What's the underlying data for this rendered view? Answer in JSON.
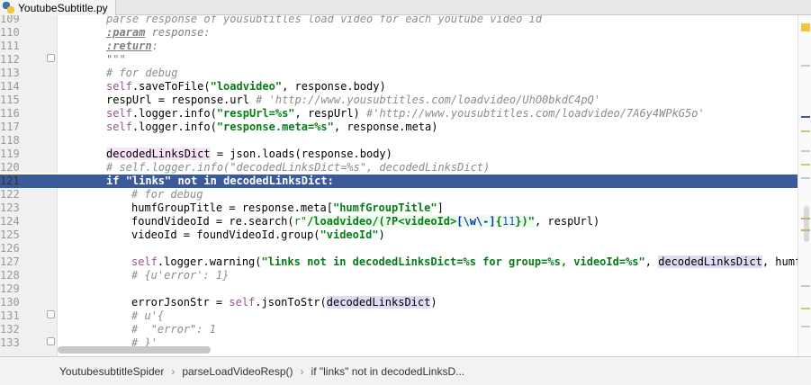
{
  "tab": {
    "title": "YoutubeSubtitle.py",
    "icon": "python-file-icon"
  },
  "editor": {
    "first_line_partial": "parse response of yousubtitles load video for each youtube video id",
    "lines": [
      {
        "n": "109"
      },
      {
        "n": "110"
      },
      {
        "n": "111"
      },
      {
        "n": "112"
      },
      {
        "n": "113"
      },
      {
        "n": "114"
      },
      {
        "n": "115"
      },
      {
        "n": "116"
      },
      {
        "n": "117"
      },
      {
        "n": "118"
      },
      {
        "n": "119"
      },
      {
        "n": "120"
      },
      {
        "n": "121"
      },
      {
        "n": "122"
      },
      {
        "n": "123"
      },
      {
        "n": "124"
      },
      {
        "n": "125"
      },
      {
        "n": "126"
      },
      {
        "n": "127"
      },
      {
        "n": "128"
      },
      {
        "n": "129"
      },
      {
        "n": "130"
      },
      {
        "n": "131"
      },
      {
        "n": "132"
      },
      {
        "n": "133"
      }
    ],
    "t": {
      "l110a": ":param",
      "l110b": " response:",
      "l111a": ":return",
      "l111b": ":",
      "l112": "\"\"\"",
      "l113": "# for debug",
      "l114a": "self",
      "l114b": ".saveToFile(",
      "l114c": "\"loadvideo\"",
      "l114d": ", response.body)",
      "l115a": "respUrl = response.url ",
      "l115b": "# 'http://www.yousubtitles.com/loadvideo/UhO0bkdC4pQ'",
      "l116a": "self",
      "l116b": ".logger.info(",
      "l116c": "\"respUrl=%s\"",
      "l116d": ", respUrl) ",
      "l116e": "#'http://www.yousubtitles.com/loadvideo/7A6y4WPkG5o'",
      "l117a": "self",
      "l117b": ".logger.info(",
      "l117c": "\"response.meta=%s\"",
      "l117d": ", response.meta)",
      "l119a": "decodedLinksDict",
      "l119b": " = json.loads(response.body)",
      "l120": "# self.logger.info(\"decodedLinksDict=%s\", decodedLinksDict)",
      "l121a": "if ",
      "l121b": "\"links\"",
      "l121c": " not in ",
      "l121d": "decodedLinksDict:",
      "l122": "# for debug",
      "l123a": "humfGroupTitle = response.meta[",
      "l123b": "\"humfGroupTitle\"",
      "l123c": "]",
      "l124a": "foundVideoId = re.search(",
      "l124b": "r\"",
      "l124c": "/loadvideo/(?P<videoId>",
      "l124d": "[\\w\\-]",
      "l124e": "{",
      "l124f": "11",
      "l124g": "})\"",
      "l124h": ", respUrl)",
      "l125a": "videoId = foundVideoId.group(",
      "l125b": "\"videoId\"",
      "l125c": ")",
      "l127a": "self",
      "l127b": ".logger.warning(",
      "l127c": "\"links not in decodedLinksDict=%s for group=%s, videoId=%s\"",
      "l127d": ", ",
      "l127e": "decodedLinksDict",
      "l127f": ", humfGroup",
      "l128": "# {u'error': 1}",
      "l130a": "errorJsonStr = ",
      "l130b": "self",
      "l130c": ".jsonToStr(",
      "l130d": "decodedLinksDict",
      "l130e": ")",
      "l131": "# u'{",
      "l132": "#  \"error\": 1",
      "l133": "# }'"
    }
  },
  "breadcrumb": {
    "items": [
      "YoutubesubtitleSpider",
      "parseLoadVideoResp()",
      "if \"links\" not in decodedLinksD..."
    ],
    "separator": "›"
  },
  "colors": {
    "current_line": "#3c5a9a",
    "string": "#067d17",
    "self": "#94558d",
    "comment": "#8c8c8c"
  }
}
